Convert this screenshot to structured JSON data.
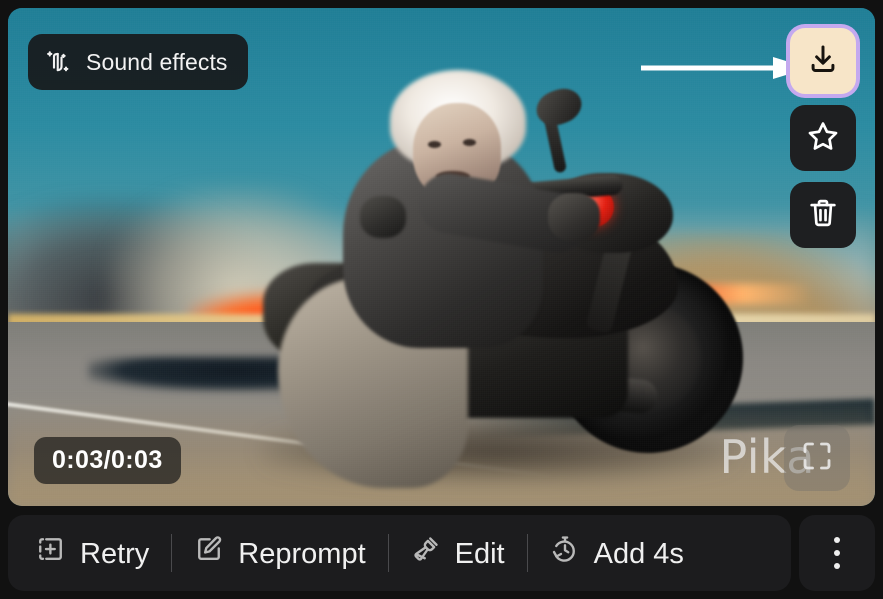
{
  "video_overlay": {
    "sound_effects_label": "Sound effects",
    "sound_effects_icon": "sound-waveform-sparkle-icon",
    "timestamp": "0:03/0:03",
    "watermark": "Pika",
    "expand_icon": "expand-fullscreen-icon",
    "actions": [
      {
        "name": "download",
        "icon": "download-icon",
        "highlighted": true,
        "bg": "#f7e5c8",
        "ring": "#c4a9ef"
      },
      {
        "name": "favorite",
        "icon": "star-outline-icon",
        "highlighted": false,
        "bg": "#1e1f21"
      },
      {
        "name": "delete",
        "icon": "trash-icon",
        "highlighted": false,
        "bg": "#1e1f21"
      }
    ],
    "annotation": {
      "type": "arrow",
      "direction": "right",
      "color": "#ffffff",
      "points_to": "download-button"
    }
  },
  "toolbar": {
    "retry_label": "Retry",
    "retry_icon": "add-frame-icon",
    "reprompt_label": "Reprompt",
    "reprompt_icon": "pencil-square-icon",
    "edit_label": "Edit",
    "edit_icon": "paintbrush-icon",
    "add4s_label": "Add 4s",
    "add4s_icon": "timer-refresh-icon",
    "more_label": "More options",
    "more_icon": "kebab-menu-icon"
  },
  "colors": {
    "page_bg": "#111111",
    "panel_bg": "#1c1c1e",
    "chip_bg": "#181a1c",
    "text": "#f0f0f0",
    "accent_ring": "#c4a9ef",
    "download_bg": "#f7e5c8"
  }
}
